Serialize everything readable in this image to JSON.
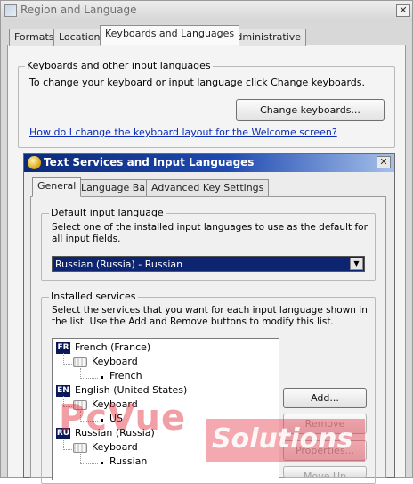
{
  "outer_window": {
    "title": "Region and Language",
    "close_glyph": "✕",
    "tabs": [
      {
        "label": "Formats"
      },
      {
        "label": "Location"
      },
      {
        "label": "Keyboards and Languages"
      },
      {
        "label": "Administrative"
      }
    ],
    "active_tab": "Keyboards and Languages",
    "keyboards_group": {
      "legend": "Keyboards and other input languages",
      "description": "To change your keyboard or input language click Change keyboards.",
      "change_button": "Change keyboards..."
    },
    "welcome_link": "How do I change the keyboard layout for the Welcome screen?"
  },
  "dialog": {
    "title": "Text Services and Input Languages",
    "close_glyph": "✕",
    "tabs": [
      {
        "label": "General"
      },
      {
        "label": "Language Bar"
      },
      {
        "label": "Advanced Key Settings"
      }
    ],
    "active_tab": "General",
    "default_input": {
      "legend": "Default input language",
      "description": "Select one of the installed input languages to use as the default for all input fields.",
      "selected": "Russian (Russia) - Russian",
      "dropdown_glyph": "▼"
    },
    "installed_services": {
      "legend": "Installed services",
      "description": "Select the services that you want for each input language shown in the list. Use the Add and Remove buttons to modify this list.",
      "tree": [
        {
          "badge": "FR",
          "language": "French (France)",
          "category": "Keyboard",
          "layout": "French"
        },
        {
          "badge": "EN",
          "language": "English (United States)",
          "category": "Keyboard",
          "layout": "US"
        },
        {
          "badge": "RU",
          "language": "Russian (Russia)",
          "category": "Keyboard",
          "layout": "Russian"
        }
      ],
      "buttons": {
        "add": "Add...",
        "remove": "Remove",
        "properties": "Properties...",
        "move_up": "Move Up"
      }
    }
  },
  "watermark": {
    "part1": "PcVue",
    "part2": "Solutions"
  },
  "colors": {
    "dialog_title_start": "#0b2a78",
    "selection_bg": "#0d2470",
    "link": "#0b2cb5",
    "watermark": "#e12837"
  }
}
